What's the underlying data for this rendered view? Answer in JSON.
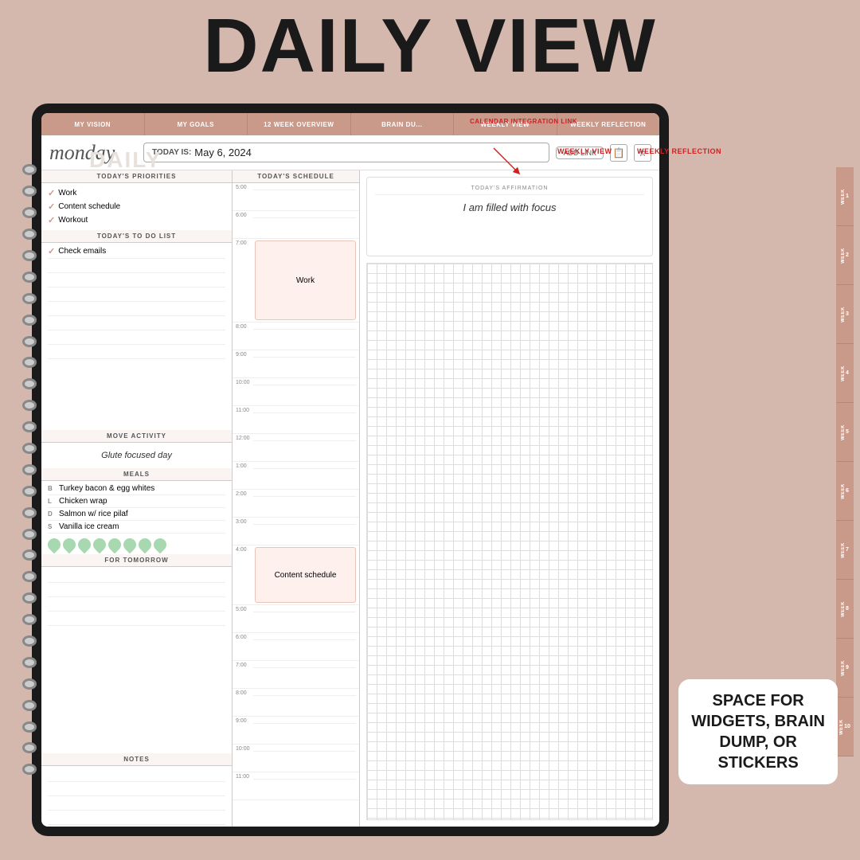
{
  "page": {
    "main_title": "DAILY VIEW",
    "background_color": "#d4b8ae"
  },
  "nav_tabs": [
    {
      "label": "MY VISION"
    },
    {
      "label": "MY GOALS"
    },
    {
      "label": "12 WEEK OVERVIEW"
    },
    {
      "label": "BRAIN DU..."
    },
    {
      "label": "WEEKLY VIEW"
    },
    {
      "label": "WEEKLY REFLECTION"
    }
  ],
  "header": {
    "day_label": "monday",
    "today_prefix": "TODAY IS:",
    "today_date": "May 6, 2024",
    "add_link_label": "ADD LINK"
  },
  "priorities": {
    "section_title": "TODAY'S PRIORITIES",
    "items": [
      {
        "text": "Work",
        "checked": true
      },
      {
        "text": "Content schedule",
        "checked": true
      },
      {
        "text": "Workout",
        "checked": true
      }
    ]
  },
  "todo": {
    "section_title": "TODAY'S TO DO LIST",
    "items": [
      {
        "text": "Check emails",
        "checked": true
      },
      {
        "text": ""
      },
      {
        "text": ""
      },
      {
        "text": ""
      },
      {
        "text": ""
      },
      {
        "text": ""
      },
      {
        "text": ""
      },
      {
        "text": ""
      }
    ]
  },
  "move_activity": {
    "section_title": "MOVE ACTIVITY",
    "text": "Glute focused day"
  },
  "meals": {
    "section_title": "MEALS",
    "items": [
      {
        "label": "B",
        "text": "Turkey bacon & egg whites"
      },
      {
        "label": "L",
        "text": "Chicken wrap"
      },
      {
        "label": "D",
        "text": "Salmon w/ rice pilaf"
      },
      {
        "label": "S",
        "text": "Vanilla ice cream"
      }
    ]
  },
  "water": {
    "drops": 8
  },
  "for_tomorrow": {
    "section_title": "FOR TOMORROW",
    "lines": 4
  },
  "notes": {
    "section_title": "NOTES",
    "lines": 4
  },
  "schedule": {
    "section_title": "TODAY'S SCHEDULE",
    "slots": [
      {
        "time": "5:00"
      },
      {
        "time": "6:00"
      },
      {
        "time": "7:00",
        "event": "Work"
      },
      {
        "time": "8:00"
      },
      {
        "time": "9:00"
      },
      {
        "time": "10:00"
      },
      {
        "time": "11:00"
      },
      {
        "time": "12:00"
      },
      {
        "time": "1:00"
      },
      {
        "time": "2:00"
      },
      {
        "time": "3:00"
      },
      {
        "time": "4:00",
        "event": "Content schedule"
      },
      {
        "time": "5:00"
      },
      {
        "time": "6:00"
      },
      {
        "time": "7:00"
      },
      {
        "time": "8:00"
      },
      {
        "time": "9:00"
      },
      {
        "time": "10:00"
      },
      {
        "time": "11:00"
      }
    ]
  },
  "affirmation": {
    "section_title": "TODAY'S AFFIRMATION",
    "text": "I am filled with focus"
  },
  "week_tabs": [
    {
      "label": "WEEK",
      "num": "1"
    },
    {
      "label": "WEEK",
      "num": "2"
    },
    {
      "label": "WEEK",
      "num": "3"
    },
    {
      "label": "WEEK",
      "num": "4"
    },
    {
      "label": "WEEK",
      "num": "5"
    },
    {
      "label": "WEEK",
      "num": "6"
    },
    {
      "label": "WEEK",
      "num": "7"
    },
    {
      "label": "WEEK",
      "num": "8"
    },
    {
      "label": "WEEK",
      "num": "9"
    },
    {
      "label": "WEEK",
      "num": "10"
    }
  ],
  "annotations": {
    "calendar_integration": "CALENDAR\nINTEGRATION\nLINK",
    "weekly_view": "WEEKLY VIEW",
    "weekly_reflection": "WEEKLY REFLECTION"
  },
  "widgets_label": "SPACE FOR\nWIDGETS, BRAIN\nDUMP, OR\nSTICKERS"
}
